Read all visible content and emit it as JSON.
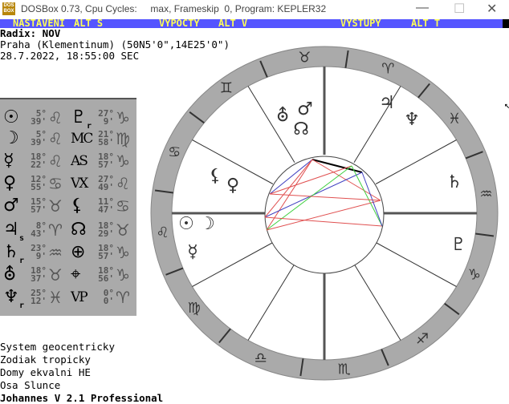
{
  "window": {
    "title": "DOSBox 0.73, Cpu Cycles:     max, Frameskip  0, Program: KEPLER32",
    "logo": "DOS BOX",
    "minimize": "—",
    "maximize": "☐",
    "close": "✕"
  },
  "menu": [
    {
      "label": "NASTAVENI"
    },
    {
      "label": "ALT S"
    },
    {
      "label": "VYPOCTY"
    },
    {
      "label": "ALT V"
    },
    {
      "label": "VYSTUPY"
    },
    {
      "label": "ALT T"
    }
  ],
  "header": {
    "radix": "Radix: NOV",
    "place": "Praha (Klementinum) (50N5'0\",14E25'0\")",
    "datetime": "28.7.2022, 18:55:00 SEC"
  },
  "table": [
    [
      {
        "glyph": "☉",
        "deg": "5°",
        "min": "39'",
        "sign": "♌"
      },
      {
        "glyph": "♇",
        "sub": "r",
        "deg": "27°",
        "min": "9'",
        "sign": "♑"
      }
    ],
    [
      {
        "glyph": "☽",
        "deg": "5°",
        "min": "39'",
        "sign": "♌"
      },
      {
        "glyph": "MC",
        "deg": "21°",
        "min": "58'",
        "sign": "♍"
      }
    ],
    [
      {
        "glyph": "☿",
        "deg": "18°",
        "min": "22'",
        "sign": "♌"
      },
      {
        "glyph": "AS",
        "deg": "18°",
        "min": "57'",
        "sign": "♑"
      }
    ],
    [
      {
        "glyph": "♀",
        "deg": "12°",
        "min": "55'",
        "sign": "♋"
      },
      {
        "glyph": "VX",
        "deg": "27°",
        "min": "49'",
        "sign": "♌"
      }
    ],
    [
      {
        "glyph": "♂",
        "deg": "15°",
        "min": "57'",
        "sign": "♉"
      },
      {
        "glyph": "⚸",
        "deg": "11°",
        "min": "47'",
        "sign": "♋"
      }
    ],
    [
      {
        "glyph": "♃",
        "sub": "s",
        "deg": "8°",
        "min": "43'",
        "sign": "♈"
      },
      {
        "glyph": "☊",
        "deg": "18°",
        "min": "29'",
        "sign": "♉"
      }
    ],
    [
      {
        "glyph": "♄",
        "sub": "r",
        "deg": "23°",
        "min": "9'",
        "sign": "♒"
      },
      {
        "glyph": "⊕",
        "deg": "18°",
        "min": "57'",
        "sign": "♑"
      }
    ],
    [
      {
        "glyph": "⛢",
        "deg": "18°",
        "min": "37'",
        "sign": "♉"
      },
      {
        "glyph": "⌖",
        "deg": "18°",
        "min": "56'",
        "sign": "♑"
      }
    ],
    [
      {
        "glyph": "♆",
        "sub": "r",
        "deg": "25°",
        "min": "12'",
        "sign": "♓"
      },
      {
        "glyph": "VP",
        "deg": "0°",
        "min": "0'",
        "sign": "♈"
      }
    ]
  ],
  "footer": [
    "System geocentricky",
    "Zodiak tropicky",
    "Domy ekvalni HE",
    "Osa Slunce",
    "Johannes V 2.1 Professional"
  ],
  "wheel": {
    "signs": [
      "♒",
      "♈",
      "♉",
      "♊",
      "♋",
      "♌",
      "♍",
      "♎",
      "♏",
      "♐",
      "♑",
      "♓"
    ],
    "planets": [
      "⛢",
      "♂",
      "☊",
      "♃",
      "♆",
      "⚸",
      "♀",
      "☉",
      "☽",
      "☿",
      "♄",
      "♇"
    ]
  },
  "colors": {
    "menu_bg": "#5555ff",
    "menu_text": "#ffff55",
    "panel": "#aaaaaa",
    "ring": "#aaaaaa",
    "aspect_red": "#e05050",
    "aspect_blue": "#4040c0",
    "aspect_green": "#40d040"
  }
}
